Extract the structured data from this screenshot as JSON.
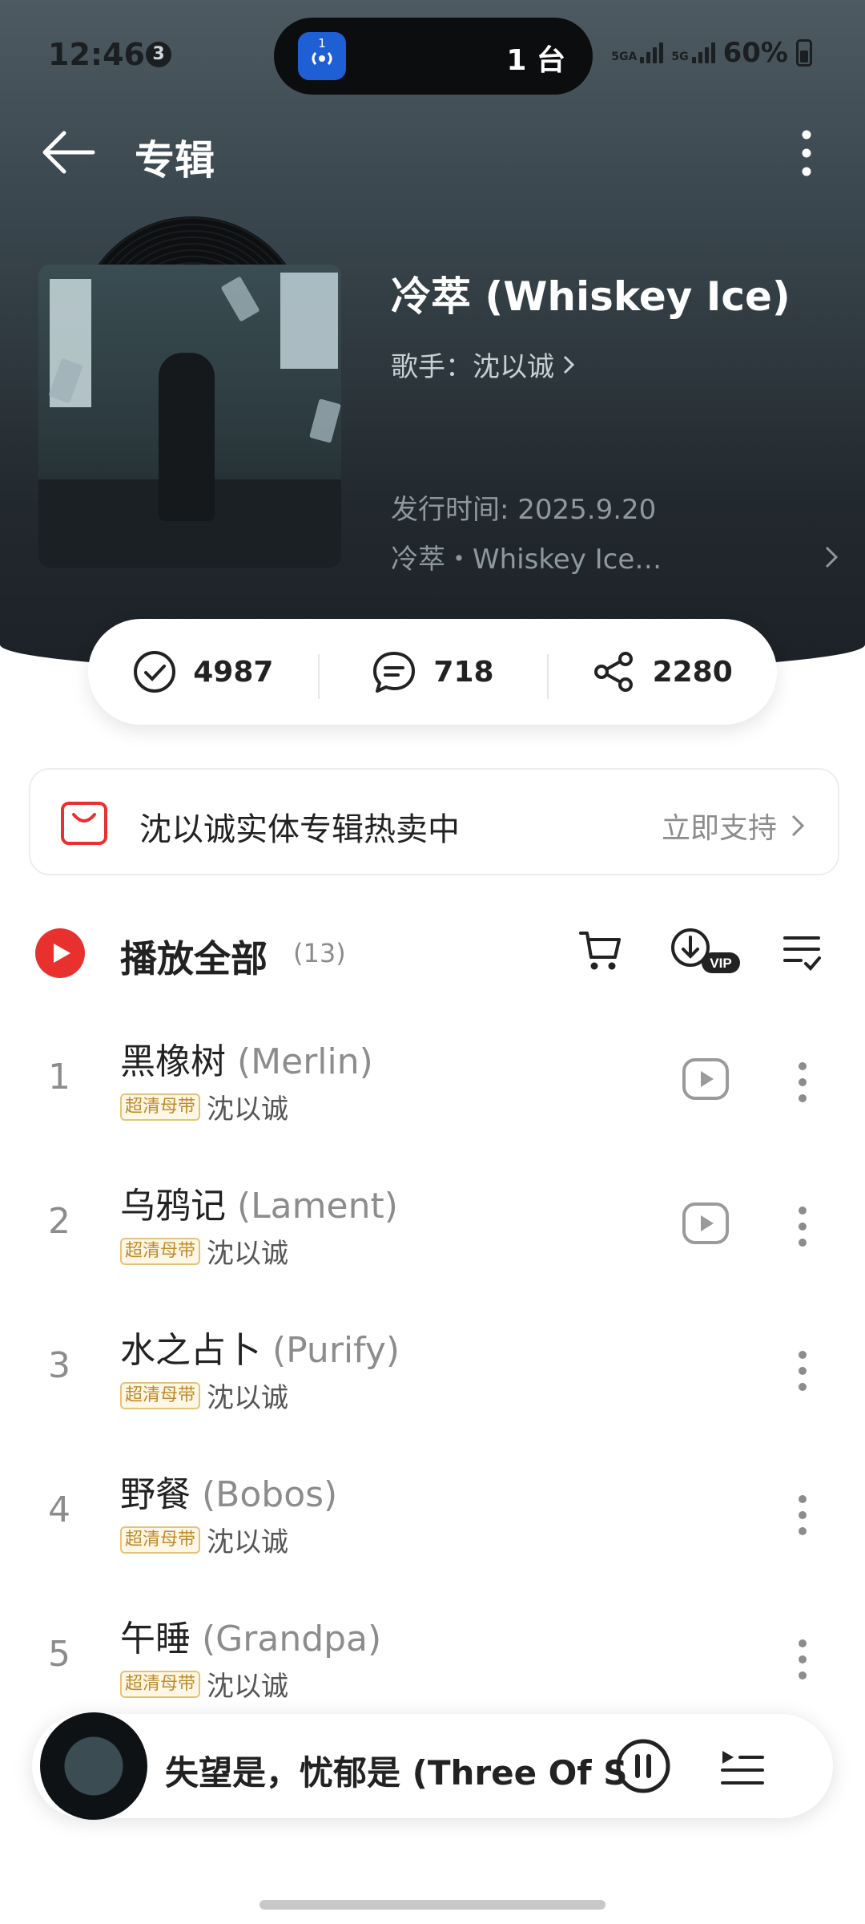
{
  "status_bar": {
    "time": "12:46",
    "notification_count": "3",
    "island_app_label": "1",
    "island_text": "1 台",
    "network1": "5GA",
    "network2": "5G",
    "battery": "60%"
  },
  "header": {
    "title": "专辑"
  },
  "album": {
    "name": "冷萃 (Whiskey Ice)",
    "artist_label": "歌手：沈以诚",
    "release": "发行时间: 2025.9.20",
    "description": "冷萃・Whiskey Ice…"
  },
  "stats": {
    "collect_count": "4987",
    "comment_count": "718",
    "share_count": "2280"
  },
  "shop_banner": {
    "text": "沈以诚实体专辑热卖中",
    "action": "立即支持"
  },
  "play_all": {
    "label": "播放全部",
    "count": "(13)"
  },
  "tracks": [
    {
      "num": "1",
      "title": "黑橡树",
      "subtitle": "(Merlin)",
      "badge": "超清母带",
      "artist": "沈以诚",
      "has_mv": true
    },
    {
      "num": "2",
      "title": "乌鸦记",
      "subtitle": "(Lament)",
      "badge": "超清母带",
      "artist": "沈以诚",
      "has_mv": true
    },
    {
      "num": "3",
      "title": "水之占卜",
      "subtitle": "(Purify)",
      "badge": "超清母带",
      "artist": "沈以诚",
      "has_mv": false
    },
    {
      "num": "4",
      "title": "野餐",
      "subtitle": "(Bobos)",
      "badge": "超清母带",
      "artist": "沈以诚",
      "has_mv": false
    },
    {
      "num": "5",
      "title": "午睡",
      "subtitle": "(Grandpa)",
      "badge": "超清母带",
      "artist": "沈以诚",
      "has_mv": false
    }
  ],
  "mini_player": {
    "title": "失望是，忧郁是 (Three Of S"
  },
  "icons": {
    "back": "back-arrow-icon",
    "more": "more-vertical-icon",
    "collect": "check-circle-icon",
    "comment": "comment-icon",
    "share": "share-icon",
    "shop": "shopping-bag-icon",
    "play": "play-icon",
    "cart": "cart-icon",
    "download": "download-vip-icon",
    "multi_select": "multi-select-icon",
    "mv": "mv-play-icon",
    "pause": "pause-icon",
    "queue": "playlist-icon"
  },
  "colors": {
    "accent_red": "#e8312f",
    "badge_gold": "#c08a2a",
    "hero_dark": "#22292e"
  }
}
